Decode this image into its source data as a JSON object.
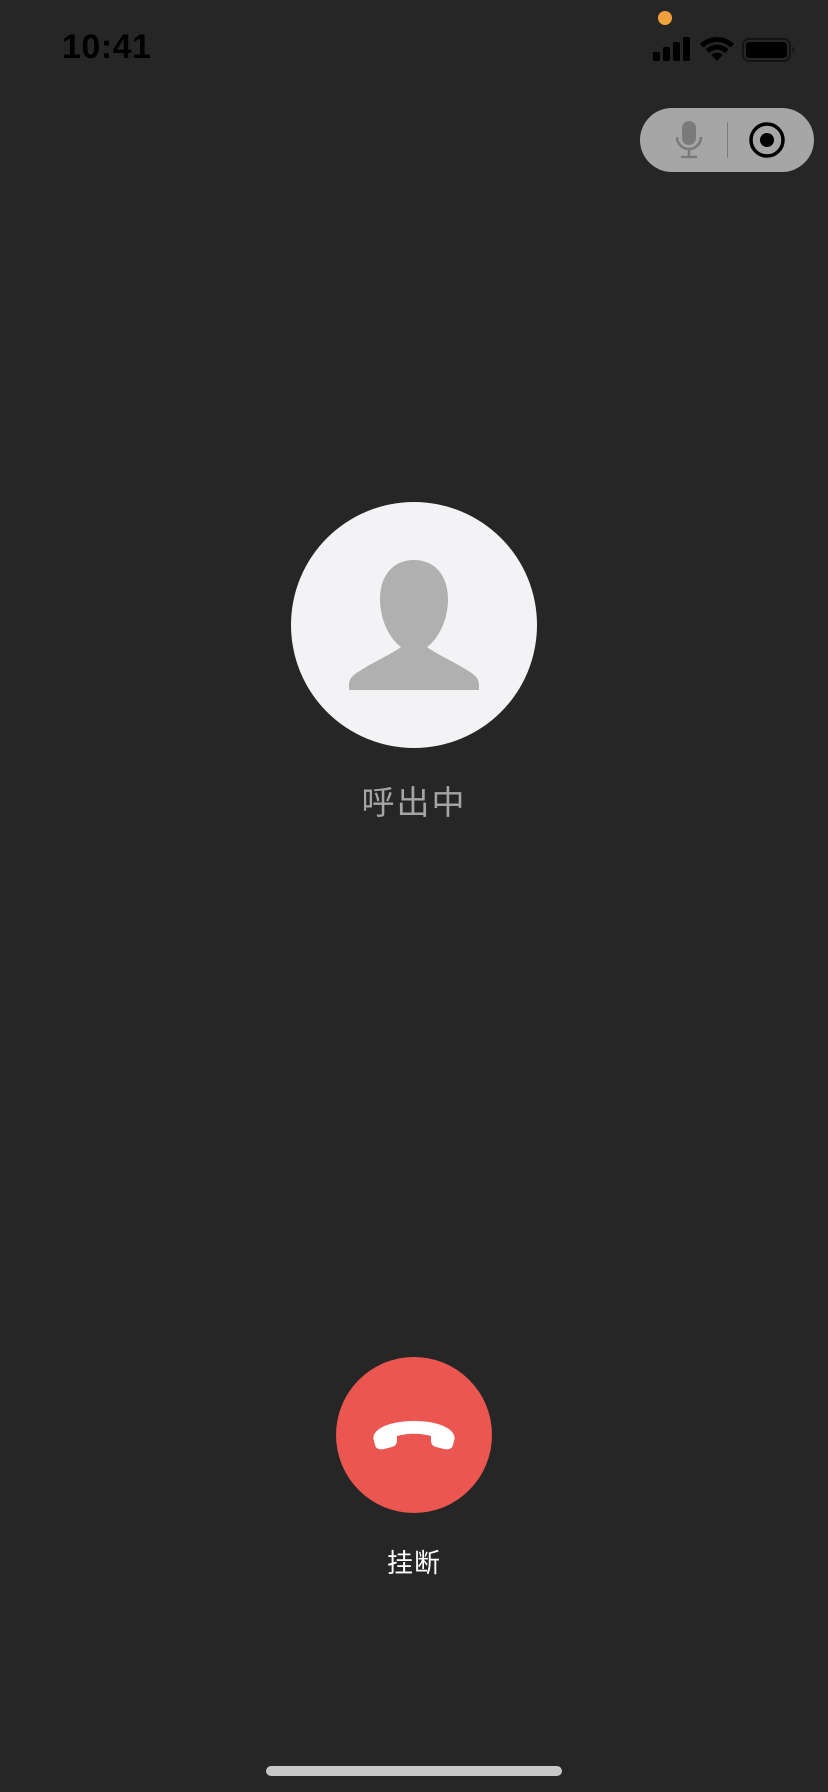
{
  "status_bar": {
    "time": "10:41",
    "icons": [
      "signal-icon",
      "wifi-icon",
      "battery-icon"
    ],
    "indicator_dot_color": "#f2a03d"
  },
  "capsule": {
    "icons": [
      "microphone-icon",
      "record-icon"
    ]
  },
  "call": {
    "status": "呼出中",
    "hangup_label": "挂断",
    "hangup_color": "#eb5650"
  },
  "colors": {
    "background": "#262626",
    "avatar_background": "#f3f3f5",
    "avatar_silhouette": "#b0b0b0"
  }
}
